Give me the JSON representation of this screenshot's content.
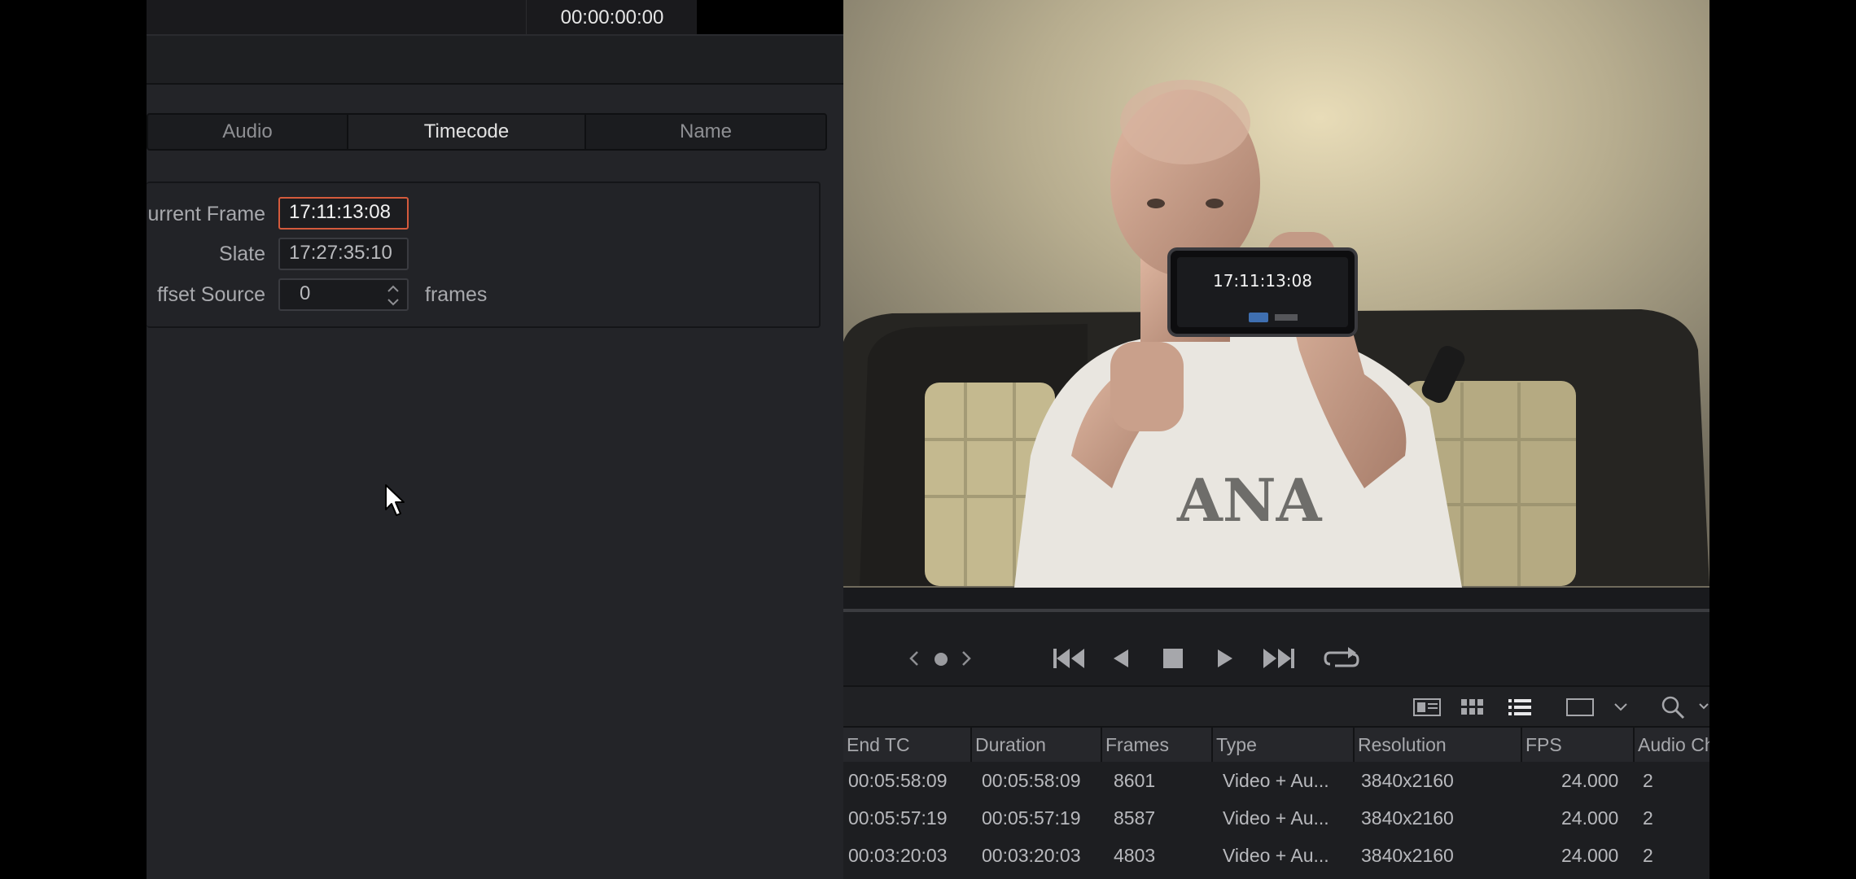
{
  "top_strip": {
    "timecode": "00:00:00:00"
  },
  "tabs": [
    {
      "label": "Audio"
    },
    {
      "label": "Timecode"
    },
    {
      "label": "Name"
    }
  ],
  "timecode_group": {
    "current_frame_label": "urrent Frame",
    "current_frame_value": "17:11:13:08",
    "slate_label": "Slate",
    "slate_value": "17:27:35:10",
    "offset_label": "ffset Source",
    "offset_value": "0",
    "offset_unit": "frames"
  },
  "video": {
    "phone_timecode": "17:11:13:08",
    "shirt_text": "ANA"
  },
  "controls": {
    "icons": [
      "prev-marker-icon",
      "marker-dot-icon",
      "next-marker-icon",
      "skip-to-start-icon",
      "step-back-icon",
      "stop-icon",
      "play-icon",
      "skip-to-end-icon",
      "loop-icon"
    ]
  },
  "media_toolbar": {
    "icons": [
      "metadata-view-icon",
      "thumbnail-view-icon",
      "list-view-icon",
      "viewer-size-icon",
      "chevron-down-icon",
      "search-icon",
      "chevron-down-icon"
    ]
  },
  "table": {
    "headers": [
      "End TC",
      "Duration",
      "Frames",
      "Type",
      "Resolution",
      "FPS",
      "Audio Ch"
    ],
    "rows": [
      [
        "00:05:58:09",
        "00:05:58:09",
        "8601",
        "Video + Au...",
        "3840x2160",
        "24.000",
        "2"
      ],
      [
        "00:05:57:19",
        "00:05:57:19",
        "8587",
        "Video + Au...",
        "3840x2160",
        "24.000",
        "2"
      ],
      [
        "00:03:20:03",
        "00:03:20:03",
        "4803",
        "Video + Au...",
        "3840x2160",
        "24.000",
        "2"
      ]
    ]
  },
  "colors": {
    "panel_bg": "#232428",
    "focus_border": "#d45a3c",
    "text": "#c9c9c9"
  }
}
